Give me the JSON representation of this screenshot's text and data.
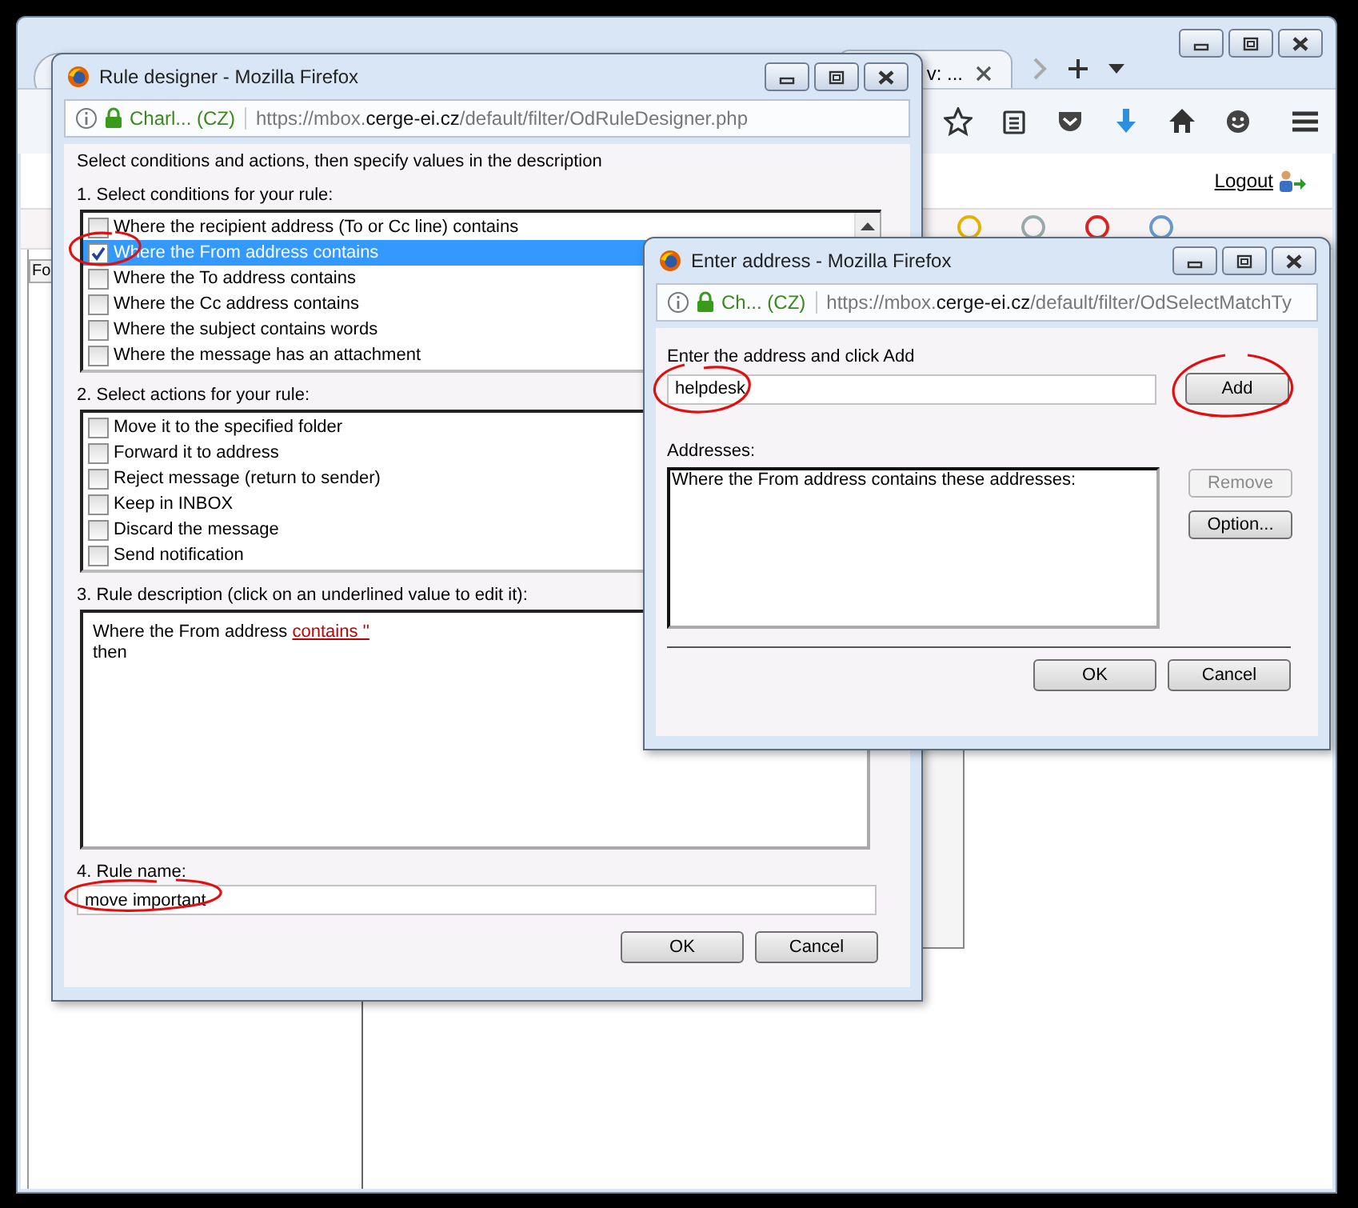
{
  "browser": {
    "tab": {
      "title": "v: ..."
    },
    "page": {
      "logout": "Logout",
      "side_tab": "Fo"
    }
  },
  "rule_designer": {
    "title": "Rule designer - Mozilla Firefox",
    "url": {
      "site": "Charl... (CZ)",
      "prefix": "https://mbox.",
      "domain": "cerge-ei.cz",
      "path": "/default/filter/OdRuleDesigner.php"
    },
    "intro": "Select conditions and actions, then specify values in the description",
    "conditions_label": "1. Select conditions for your rule:",
    "conditions": [
      {
        "label": "Where the recipient address (To or Cc line) contains",
        "checked": false,
        "selected": false
      },
      {
        "label": "Where the From address contains",
        "checked": true,
        "selected": true
      },
      {
        "label": "Where the To address contains",
        "checked": false,
        "selected": false
      },
      {
        "label": "Where the Cc address contains",
        "checked": false,
        "selected": false
      },
      {
        "label": "Where the subject contains words",
        "checked": false,
        "selected": false
      },
      {
        "label": "Where the message has an attachment",
        "checked": false,
        "selected": false
      }
    ],
    "actions_label": "2. Select actions for your rule:",
    "actions": [
      {
        "label": "Move it to the specified folder",
        "checked": false
      },
      {
        "label": "Forward it to address",
        "checked": false
      },
      {
        "label": "Reject message (return to sender)",
        "checked": false
      },
      {
        "label": "Keep in INBOX",
        "checked": false
      },
      {
        "label": "Discard the message",
        "checked": false
      },
      {
        "label": "Send notification",
        "checked": false
      }
    ],
    "description_label": "3. Rule description (click on an underlined value to edit it):",
    "description": {
      "text": "Where the From address",
      "link": "contains ''",
      "next": "then"
    },
    "name_label": "4. Rule name:",
    "name_value": "move important",
    "buttons": [
      "OK",
      "Cancel"
    ]
  },
  "enter_address": {
    "title": "Enter address - Mozilla Firefox",
    "url": {
      "site": "Ch... (CZ)",
      "prefix": "https://mbox.",
      "domain": "cerge-ei.cz",
      "path": "/default/filter/OdSelectMatchTy"
    },
    "address_label": "Enter the address and click Add",
    "address_value": "helpdesk",
    "add_button": "Add",
    "addresses_label": "Addresses:",
    "addresses_header": "Where the From address contains these addresses:",
    "side_buttons": [
      {
        "label": "Remove",
        "disabled": true
      },
      {
        "label": "Option...",
        "disabled": false
      }
    ],
    "buttons": [
      "OK",
      "Cancel"
    ]
  }
}
